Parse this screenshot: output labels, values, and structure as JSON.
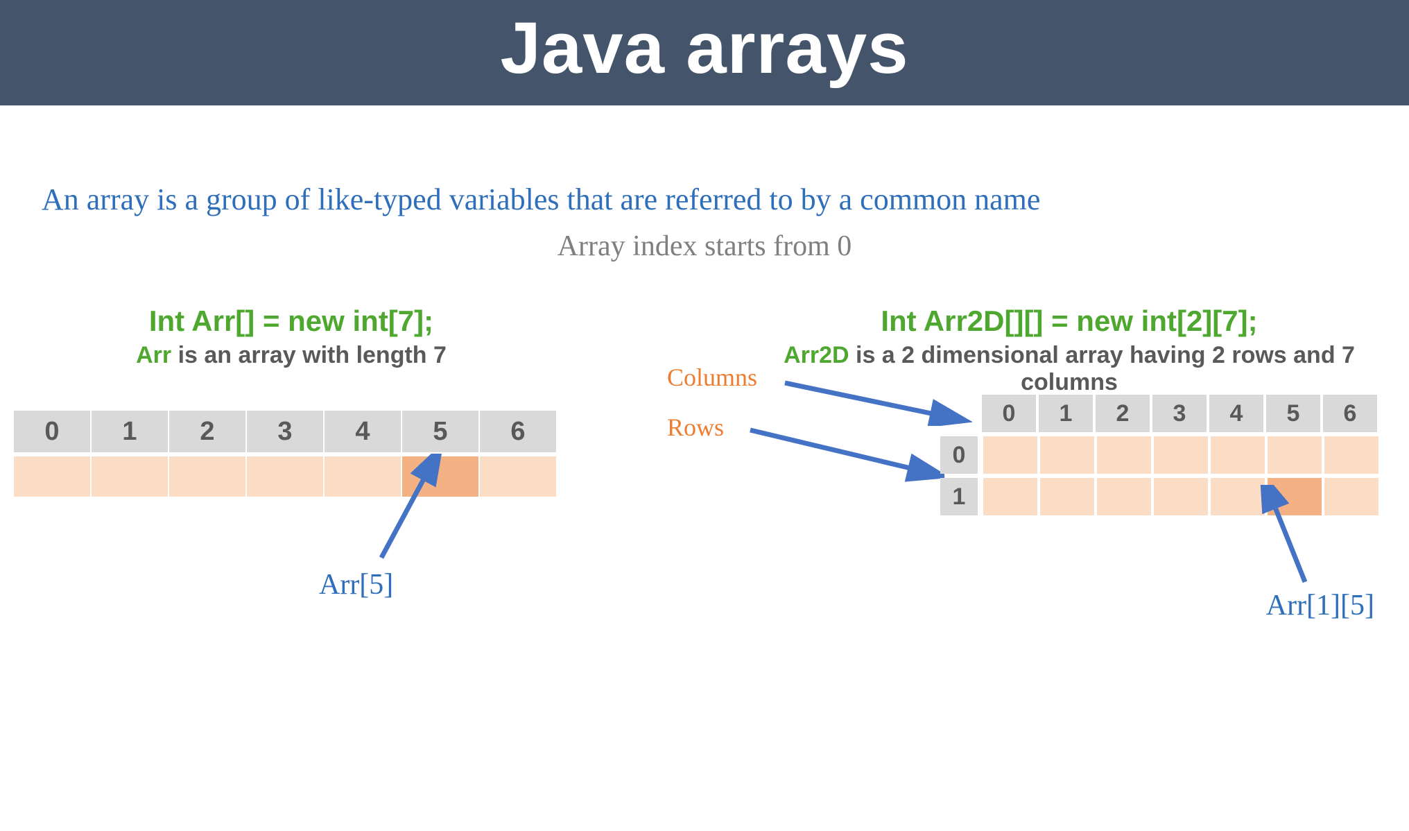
{
  "header": {
    "title": "Java arrays"
  },
  "definition": "An array is a group of like-typed variables that are referred to by a common name",
  "subnote": "Array index starts from 0",
  "left": {
    "declaration": "Int Arr[] = new int[7];",
    "arrname": "Arr",
    "desc_rest": " is an array with length 7",
    "indices": [
      "0",
      "1",
      "2",
      "3",
      "4",
      "5",
      "6"
    ],
    "highlightIndex": 5,
    "pointerLabel": "Arr[5]"
  },
  "right": {
    "declaration": "Int Arr2D[][] = new int[2][7];",
    "arrname": "Arr2D",
    "desc_rest": " is a 2 dimensional array having 2 rows and 7 columns",
    "colLabel": "Columns",
    "rowLabel": "Rows",
    "colHeaders": [
      "0",
      "1",
      "2",
      "3",
      "4",
      "5",
      "6"
    ],
    "rowHeaders": [
      "0",
      "1"
    ],
    "highlight": {
      "row": 1,
      "col": 5
    },
    "pointerLabel": "Arr[1][5]"
  },
  "chart_data": {
    "type": "table",
    "title": "Java arrays illustration",
    "arrays": [
      {
        "name": "Arr",
        "kind": "1D",
        "declaration": "int Arr[] = new int[7];",
        "length": 7,
        "indices": [
          0,
          1,
          2,
          3,
          4,
          5,
          6
        ],
        "highlighted_index": 5,
        "reference": "Arr[5]"
      },
      {
        "name": "Arr2D",
        "kind": "2D",
        "declaration": "int Arr2D[][] = new int[2][7];",
        "rows": 2,
        "cols": 7,
        "row_indices": [
          0,
          1
        ],
        "col_indices": [
          0,
          1,
          2,
          3,
          4,
          5,
          6
        ],
        "highlighted_cell": [
          1,
          5
        ],
        "reference": "Arr[1][5]"
      }
    ],
    "notes": [
      "An array is a group of like-typed variables that are referred to by a common name",
      "Array index starts from 0"
    ]
  }
}
